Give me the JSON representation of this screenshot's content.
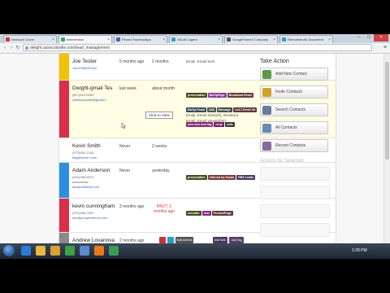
{
  "browser": {
    "tabs": [
      {
        "label": "Nextdoor Grove",
        "fav": "#c33"
      },
      {
        "label": "Intervention",
        "fav": "#3a6"
      },
      {
        "label": "Pinned Facebookpa",
        "fav": "#46a"
      },
      {
        "label": "SKLBO Agent",
        "fav": "#49c"
      },
      {
        "label": "GoogleHome3 Company",
        "fav": "#555"
      },
      {
        "label": "Remoteaholic Document",
        "fav": "#39c"
      }
    ],
    "url": "dwight.assocolaville.com/lead_management",
    "controls": {
      "minimize": "–",
      "maximize": "□",
      "close": "×"
    },
    "nav": {
      "back": "‹",
      "forward": "›",
      "reload": "↻"
    }
  },
  "sidebar": {
    "title": "Take Action",
    "buttons": [
      {
        "label": "Add New Contact",
        "icon": "add-contact-icon"
      },
      {
        "label": "Invite Contacts",
        "icon": "invite-icon"
      },
      {
        "label": "Search Contacts",
        "icon": "search-icon"
      },
      {
        "label": "All Contacts",
        "icon": "contacts-icon"
      },
      {
        "label": "Recent Contacts",
        "icon": "recent-icon"
      }
    ],
    "section2_title": "Actions for Selected"
  },
  "contacts": [
    {
      "name": "Joe Tester",
      "sub": [
        "Joe#78@MFcom"
      ],
      "added": "5 months ago",
      "last": "2 months",
      "status": [
        "Email, Email Sent"
      ],
      "bar": "#f2c200",
      "tags": []
    },
    {
      "name": "Dwight-gmail Tes",
      "sub": [
        "(817)813-9054",
        "cdwilsongmail@gmail.c"
      ],
      "added": "last week",
      "last": "about month",
      "status": [
        "Email, Email Sent(20), Breakout",
        "Email, Email Viewed(20)"
      ],
      "bar": "#d9304a",
      "tags": [
        {
          "label": "preservation",
          "color": "#4a4a22"
        },
        {
          "label": "BizOpPage",
          "color": "#8a3a9a"
        },
        {
          "label": "Broadcast Email",
          "color": "#6a3a3a"
        },
        {
          "label": "BizOp Email",
          "color": "#3a4a5a"
        },
        {
          "label": "Call",
          "color": "#4a5a4a"
        },
        {
          "label": "Message",
          "color": "#4a4a4a"
        },
        {
          "label": "List 2 Email Vit",
          "color": "#5a3a3a"
        },
        {
          "label": "new new new tag",
          "color": "#8a2a7a"
        },
        {
          "label": "ninja",
          "color": "#7a1a6a"
        },
        {
          "label": "calls",
          "color": "#3a3a3a"
        }
      ],
      "tooltip": "Click to View"
    },
    {
      "name": "Kevin Smith",
      "sub": [
        "(972)551-1234",
        "kbg@frozen.com"
      ],
      "added": "Never",
      "last": "2 weeks",
      "status": [],
      "bar": "#ffffff",
      "tags": []
    },
    {
      "name": "Adam Anderson",
      "sub": [
        "(651)955-8972",
        "adam4kids",
        "aba@cdkmail.com"
      ],
      "added": "Never",
      "last": "yesterday",
      "status": [],
      "bar": "#2d8fe0",
      "tags": [
        {
          "label": "preservation",
          "color": "#4a4a22"
        },
        {
          "label": "referred by Susan",
          "color": "#7a3a3a"
        },
        {
          "label": "RBS Leads",
          "color": "#4a3a5a"
        }
      ]
    },
    {
      "name": "kevin cunningham",
      "sub": [
        "(972)466-7091",
        "kev@prosperbench.com"
      ],
      "added": "3 months ago",
      "last": "PAST! 2 months ago",
      "status": [],
      "bar": "#d9304a",
      "tags": [
        {
          "label": "recruiter",
          "color": "#4a4a22"
        },
        {
          "label": "new",
          "color": "#8a2a7a"
        },
        {
          "label": "ProductPage",
          "color": "#5a3a3a"
        }
      ]
    },
    {
      "name": "Andrew Lovanova",
      "sub": [],
      "added": "2 months ago",
      "last": "",
      "status": [],
      "bar": "#8a8a8a",
      "tags": []
    }
  ],
  "floating_toolbar": [
    {
      "label": "",
      "color": "#c33"
    },
    {
      "label": "",
      "color": "#39c"
    },
    {
      "label": "Bulk Actions",
      "color": "#555"
    },
    {
      "label": "Add Note",
      "color": "#4a3a5a"
    },
    {
      "label": "Add Tag",
      "color": "#5a3a6a"
    }
  ],
  "taskbar": {
    "icons": [
      {
        "name": "ie-icon",
        "color": "#2a7ad8"
      },
      {
        "name": "explorer-icon",
        "color": "#e8b840"
      },
      {
        "name": "media-icon",
        "color": "#d8a030"
      },
      {
        "name": "chrome-icon",
        "color": "#3aa04a"
      },
      {
        "name": "email-icon",
        "color": "#5a8ad0"
      },
      {
        "name": "vlc-icon",
        "color": "#e87a1a"
      },
      {
        "name": "camtasia-icon",
        "color": "#3a9a5a"
      }
    ],
    "clock": "1:28 PM"
  }
}
